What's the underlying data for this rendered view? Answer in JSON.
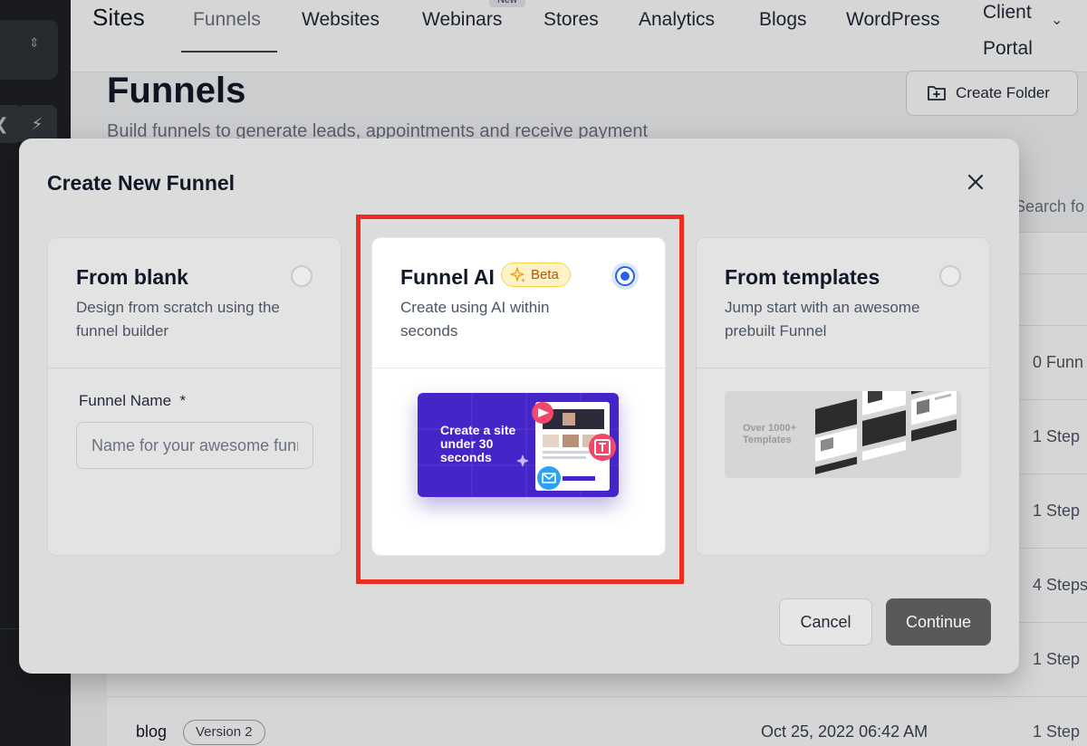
{
  "nav": {
    "brand": "Sites",
    "items": [
      "Funnels",
      "Websites",
      "Webinars",
      "Stores",
      "Analytics",
      "Blogs",
      "WordPress"
    ],
    "new_badge": "New",
    "client_portal": "Client Portal"
  },
  "page": {
    "title": "Funnels",
    "subtitle": "Build funnels to generate leads, appointments and receive payment",
    "create_folder": "Create Folder",
    "search_partial": "Search fo"
  },
  "background_table": {
    "steps": [
      "0 Funn",
      "1 Step",
      "1 Step",
      "4 Steps",
      "1 Step",
      "1 Step"
    ],
    "last_row": {
      "name": "blog",
      "version": "Version 2",
      "date": "Oct 25, 2022 06:42 AM"
    }
  },
  "modal": {
    "title": "Create New Funnel",
    "options": {
      "blank": {
        "title": "From blank",
        "description": "Design from scratch using the funnel builder",
        "selected": false
      },
      "ai": {
        "title": "Funnel AI",
        "badge": "Beta",
        "description": "Create using AI within seconds",
        "selected": true
      },
      "templates": {
        "title": "From templates",
        "description": "Jump start with an awesome prebuilt Funnel",
        "selected": false
      }
    },
    "field": {
      "label": "Funnel Name",
      "required_mark": "*",
      "placeholder": "Name for your awesome funnel"
    },
    "ai_preview_text": "Create a site under 30 seconds",
    "templates_preview_text": "Over 1000+ Templates",
    "cancel": "Cancel",
    "continue": "Continue"
  },
  "colors": {
    "highlight": "#ee2b1f",
    "radio_selected": "#2563eb",
    "ai_preview_bg": "#4524c8",
    "beta_text": "#b45309"
  }
}
